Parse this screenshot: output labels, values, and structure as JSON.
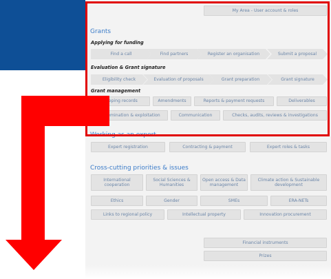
{
  "top": {
    "my_area": "My Area - User account & roles"
  },
  "grants": {
    "title": "Grants",
    "applying": {
      "title": "Applying for funding",
      "steps": [
        "Find a call",
        "Find partners",
        "Register an organisation",
        "Submit a proposal"
      ]
    },
    "evaluation": {
      "title": "Evaluation & Grant signature",
      "steps": [
        "Eligibility check",
        "Evaluation of proposals",
        "Grant preparation",
        "Grant signature"
      ]
    },
    "management": {
      "title": "Grant management",
      "row1": [
        "Keeping records",
        "Amendments",
        "Reports & payment requests",
        "Deliverables"
      ],
      "row2": [
        "Dissemination & exploitation",
        "Communication",
        "Checks, audits, reviews & investigations"
      ]
    }
  },
  "expert": {
    "title": "Working as an expert",
    "items": [
      "Expert registration",
      "Contracting & payment",
      "Expert roles & tasks"
    ]
  },
  "crosscutting": {
    "title": "Cross-cutting priorities & issues",
    "row1": [
      "International cooperation",
      "Social Sciences & Humanities",
      "Open access & Data management",
      "Climate action & Sustainable development"
    ],
    "row2": [
      "Ethics",
      "Gender",
      "SMEs",
      "ERA-NETs"
    ],
    "row3": [
      "Links to regional policy",
      "Intellectual property",
      "Innovation procurement"
    ]
  },
  "other": {
    "items": [
      "Financial instruments",
      "Prizes"
    ]
  },
  "colors": {
    "highlight": "#e10000",
    "band": "#0e4f96",
    "heading": "#3a7bc8",
    "button_text": "#6a85a8"
  }
}
